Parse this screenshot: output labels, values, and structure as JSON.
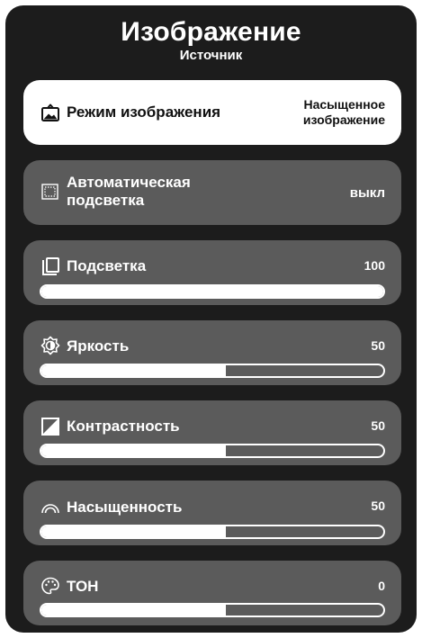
{
  "header": {
    "title": "Изображение",
    "subtitle": "Источник"
  },
  "menu": [
    {
      "id": "picture-mode",
      "icon": "picture-mode-icon",
      "label": "Режим изображения",
      "value": "Насыщенное изображение",
      "selected": true
    },
    {
      "id": "auto-backlight",
      "icon": "auto-backlight-icon",
      "label": "Автоматическая подсветка",
      "value": "выкл",
      "selected": false
    },
    {
      "id": "backlight",
      "icon": "backlight-icon",
      "label": "Подсветка",
      "value": "100",
      "level": 1.0
    },
    {
      "id": "brightness",
      "icon": "brightness-icon",
      "label": "Яркость",
      "value": "50",
      "level": 0.54
    },
    {
      "id": "contrast",
      "icon": "contrast-icon",
      "label": "Контрастность",
      "value": "50",
      "level": 0.54
    },
    {
      "id": "saturation",
      "icon": "saturation-icon",
      "label": "Насыщенность",
      "value": "50",
      "level": 0.54
    },
    {
      "id": "tint",
      "icon": "palette-icon",
      "label": "ТОН",
      "value": "0",
      "level": 0.54
    }
  ],
  "colors": {
    "panel": "#1c1c1c",
    "card": "#5b5b5b",
    "selected_card": "#ffffff",
    "accent": "#ffffff"
  }
}
